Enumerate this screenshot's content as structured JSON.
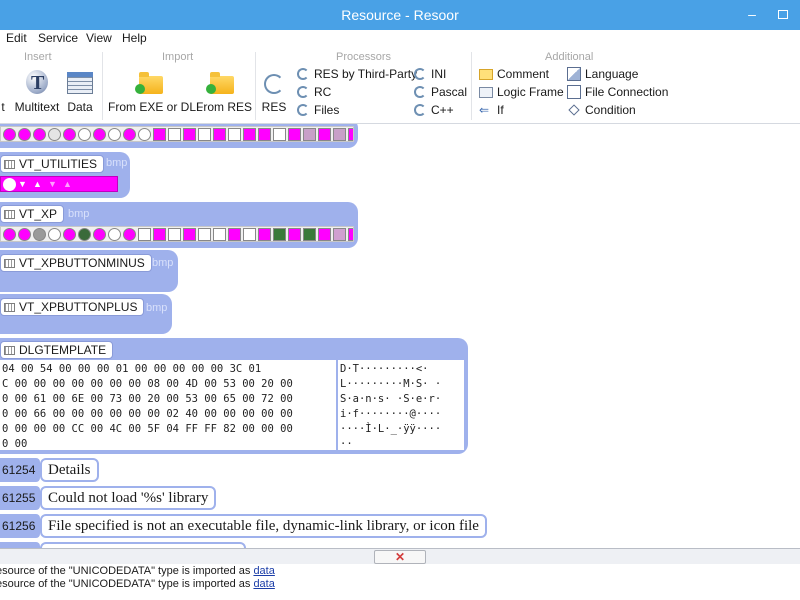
{
  "window": {
    "title": "Resource - Resoor",
    "minimize": "–"
  },
  "menu": [
    "Edit",
    "Service",
    "View",
    "Help"
  ],
  "ribbon": {
    "insert_title": "Insert",
    "import_title": "Import",
    "processors_title": "Processors",
    "additional_title": "Additional",
    "insert": {
      "text_cut": "t",
      "multitext": "Multitext",
      "data": "Data"
    },
    "import": {
      "from_exe": "From EXE or DLL",
      "from_res": "From RES"
    },
    "processors": {
      "res": "RES",
      "res_third_party": "RES by Third-Party",
      "rc": "RC",
      "files": "Files",
      "ini": "INI",
      "pascal": "Pascal",
      "cpp": "C++"
    },
    "additional": {
      "comment": "Comment",
      "logic_frame": "Logic Frame",
      "if": "If",
      "language": "Language",
      "file_connection": "File Connection",
      "condition": "Condition"
    }
  },
  "resources": {
    "vt_utilities": {
      "name": "VT_UTILITIES",
      "kind": "bmp"
    },
    "vt_xp": {
      "name": "VT_XP",
      "kind": "bmp"
    },
    "vt_xpbuttonminus": {
      "name": "VT_XPBUTTONMINUS",
      "kind": "bmp"
    },
    "vt_xpbuttonplus": {
      "name": "VT_XPBUTTONPLUS",
      "kind": "bmp"
    },
    "dlgtemplate": {
      "name": "DLGTEMPLATE",
      "hex": "04 00 54 00 00 00 01 00 00 00 00 00 3C 01\nC 00 00 00 00 00 00 00 08 00 4D 00 53 00 20 00\n0 00 61 00 6E 00 73 00 20 00 53 00 65 00 72 00\n0 00 66 00 00 00 00 00 00 02 40 00 00 00 00 00\n0 00 00 00 CC 00 4C 00 5F 04 FF FF 82 00 00 00\n0 00",
      "ascii": "D·T·········<·\nL·········M·S· ·\nS·a·n·s· ·S·e·r·\ni·f········@····\n····Ì·L·_·ÿÿ····\n··"
    }
  },
  "strings": [
    {
      "id": "61254",
      "text": "Details"
    },
    {
      "id": "61255",
      "text": "Could not load '%s' library"
    },
    {
      "id": "61256",
      "text": "File specified is not an executable file, dynamic-link library, or icon file"
    }
  ],
  "log": [
    {
      "text": "esource of the \"UNICODEDATA\" type is imported as ",
      "link": "data"
    },
    {
      "text": "esource of the \"UNICODEDATA\" type is imported as ",
      "link": "data"
    }
  ],
  "colors": {
    "titlebar": "#49a1e6",
    "panel": "#9fb1ec",
    "magenta": "#ff00ff",
    "link": "#1b3da8"
  }
}
